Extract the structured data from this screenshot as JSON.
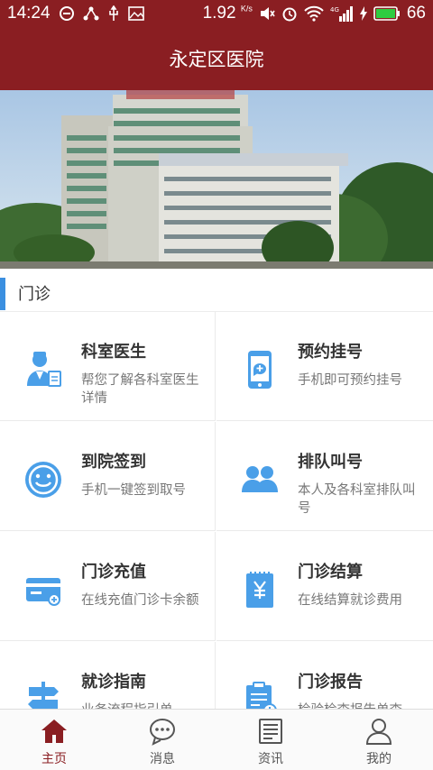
{
  "status_bar": {
    "time": "14:24",
    "speed": "1.92",
    "speed_unit": "K/s",
    "network": "4G",
    "battery": "66"
  },
  "header": {
    "title": "永定区医院"
  },
  "banner": {
    "image_alt": "hospital-building-photo"
  },
  "section": {
    "label": "门诊"
  },
  "services": [
    {
      "icon": "doctor-icon",
      "title": "科室医生",
      "desc": "帮您了解各科室医生详情"
    },
    {
      "icon": "phone-appointment-icon",
      "title": "预约挂号",
      "desc": "手机即可预约挂号"
    },
    {
      "icon": "smile-checkin-icon",
      "title": "到院签到",
      "desc": "手机一键签到取号"
    },
    {
      "icon": "people-queue-icon",
      "title": "排队叫号",
      "desc": "本人及各科室排队叫号"
    },
    {
      "icon": "card-recharge-icon",
      "title": "门诊充值",
      "desc": "在线充值门诊卡余额"
    },
    {
      "icon": "yuan-bill-icon",
      "title": "门诊结算",
      "desc": "在线结算就诊费用"
    },
    {
      "icon": "signpost-icon",
      "title": "就诊指南",
      "desc": "业务流程指引单"
    },
    {
      "icon": "clipboard-report-icon",
      "title": "门诊报告",
      "desc": "检验检查报告单查"
    }
  ],
  "tabs": [
    {
      "label": "主页",
      "icon": "home-icon",
      "active": true
    },
    {
      "label": "消息",
      "icon": "message-icon",
      "active": false
    },
    {
      "label": "资讯",
      "icon": "news-icon",
      "active": false
    },
    {
      "label": "我的",
      "icon": "user-icon",
      "active": false
    }
  ],
  "colors": {
    "brand": "#8a1e22",
    "accent": "#3b8fe0",
    "icon_blue": "#4a9fe8"
  }
}
